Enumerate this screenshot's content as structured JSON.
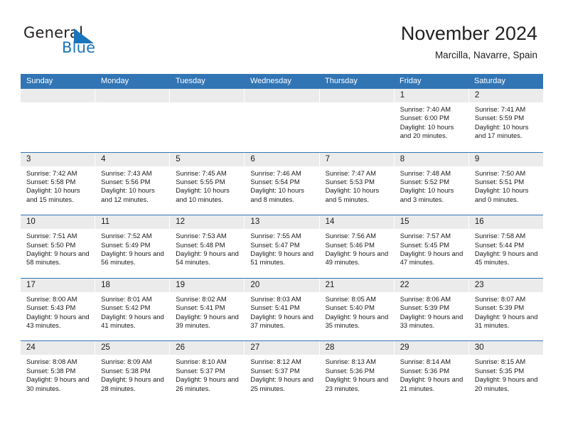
{
  "brand": {
    "name_top": "General",
    "name_bottom": "Blue",
    "top_color": "#231f20",
    "bottom_color": "#1b75bb",
    "triangle_color": "#1b75bb"
  },
  "header": {
    "title": "November 2024",
    "subtitle": "Marcilla, Navarre, Spain"
  },
  "theme": {
    "header_blue": "#3275b5",
    "daynum_band": "#ebebeb",
    "text": "#1a1a1a"
  },
  "calendar": {
    "weekday_headers": [
      "Sunday",
      "Monday",
      "Tuesday",
      "Wednesday",
      "Thursday",
      "Friday",
      "Saturday"
    ],
    "labels": {
      "sunrise": "Sunrise:",
      "sunset": "Sunset:",
      "daylight": "Daylight:"
    },
    "weeks": [
      [
        {
          "day": "",
          "empty": true
        },
        {
          "day": "",
          "empty": true
        },
        {
          "day": "",
          "empty": true
        },
        {
          "day": "",
          "empty": true
        },
        {
          "day": "",
          "empty": true
        },
        {
          "day": "1",
          "sunrise": "Sunrise: 7:40 AM",
          "sunset": "Sunset: 6:00 PM",
          "daylight": "Daylight: 10 hours and 20 minutes."
        },
        {
          "day": "2",
          "sunrise": "Sunrise: 7:41 AM",
          "sunset": "Sunset: 5:59 PM",
          "daylight": "Daylight: 10 hours and 17 minutes."
        }
      ],
      [
        {
          "day": "3",
          "sunrise": "Sunrise: 7:42 AM",
          "sunset": "Sunset: 5:58 PM",
          "daylight": "Daylight: 10 hours and 15 minutes."
        },
        {
          "day": "4",
          "sunrise": "Sunrise: 7:43 AM",
          "sunset": "Sunset: 5:56 PM",
          "daylight": "Daylight: 10 hours and 12 minutes."
        },
        {
          "day": "5",
          "sunrise": "Sunrise: 7:45 AM",
          "sunset": "Sunset: 5:55 PM",
          "daylight": "Daylight: 10 hours and 10 minutes."
        },
        {
          "day": "6",
          "sunrise": "Sunrise: 7:46 AM",
          "sunset": "Sunset: 5:54 PM",
          "daylight": "Daylight: 10 hours and 8 minutes."
        },
        {
          "day": "7",
          "sunrise": "Sunrise: 7:47 AM",
          "sunset": "Sunset: 5:53 PM",
          "daylight": "Daylight: 10 hours and 5 minutes."
        },
        {
          "day": "8",
          "sunrise": "Sunrise: 7:48 AM",
          "sunset": "Sunset: 5:52 PM",
          "daylight": "Daylight: 10 hours and 3 minutes."
        },
        {
          "day": "9",
          "sunrise": "Sunrise: 7:50 AM",
          "sunset": "Sunset: 5:51 PM",
          "daylight": "Daylight: 10 hours and 0 minutes."
        }
      ],
      [
        {
          "day": "10",
          "sunrise": "Sunrise: 7:51 AM",
          "sunset": "Sunset: 5:50 PM",
          "daylight": "Daylight: 9 hours and 58 minutes."
        },
        {
          "day": "11",
          "sunrise": "Sunrise: 7:52 AM",
          "sunset": "Sunset: 5:49 PM",
          "daylight": "Daylight: 9 hours and 56 minutes."
        },
        {
          "day": "12",
          "sunrise": "Sunrise: 7:53 AM",
          "sunset": "Sunset: 5:48 PM",
          "daylight": "Daylight: 9 hours and 54 minutes."
        },
        {
          "day": "13",
          "sunrise": "Sunrise: 7:55 AM",
          "sunset": "Sunset: 5:47 PM",
          "daylight": "Daylight: 9 hours and 51 minutes."
        },
        {
          "day": "14",
          "sunrise": "Sunrise: 7:56 AM",
          "sunset": "Sunset: 5:46 PM",
          "daylight": "Daylight: 9 hours and 49 minutes."
        },
        {
          "day": "15",
          "sunrise": "Sunrise: 7:57 AM",
          "sunset": "Sunset: 5:45 PM",
          "daylight": "Daylight: 9 hours and 47 minutes."
        },
        {
          "day": "16",
          "sunrise": "Sunrise: 7:58 AM",
          "sunset": "Sunset: 5:44 PM",
          "daylight": "Daylight: 9 hours and 45 minutes."
        }
      ],
      [
        {
          "day": "17",
          "sunrise": "Sunrise: 8:00 AM",
          "sunset": "Sunset: 5:43 PM",
          "daylight": "Daylight: 9 hours and 43 minutes."
        },
        {
          "day": "18",
          "sunrise": "Sunrise: 8:01 AM",
          "sunset": "Sunset: 5:42 PM",
          "daylight": "Daylight: 9 hours and 41 minutes."
        },
        {
          "day": "19",
          "sunrise": "Sunrise: 8:02 AM",
          "sunset": "Sunset: 5:41 PM",
          "daylight": "Daylight: 9 hours and 39 minutes."
        },
        {
          "day": "20",
          "sunrise": "Sunrise: 8:03 AM",
          "sunset": "Sunset: 5:41 PM",
          "daylight": "Daylight: 9 hours and 37 minutes."
        },
        {
          "day": "21",
          "sunrise": "Sunrise: 8:05 AM",
          "sunset": "Sunset: 5:40 PM",
          "daylight": "Daylight: 9 hours and 35 minutes."
        },
        {
          "day": "22",
          "sunrise": "Sunrise: 8:06 AM",
          "sunset": "Sunset: 5:39 PM",
          "daylight": "Daylight: 9 hours and 33 minutes."
        },
        {
          "day": "23",
          "sunrise": "Sunrise: 8:07 AM",
          "sunset": "Sunset: 5:39 PM",
          "daylight": "Daylight: 9 hours and 31 minutes."
        }
      ],
      [
        {
          "day": "24",
          "sunrise": "Sunrise: 8:08 AM",
          "sunset": "Sunset: 5:38 PM",
          "daylight": "Daylight: 9 hours and 30 minutes."
        },
        {
          "day": "25",
          "sunrise": "Sunrise: 8:09 AM",
          "sunset": "Sunset: 5:38 PM",
          "daylight": "Daylight: 9 hours and 28 minutes."
        },
        {
          "day": "26",
          "sunrise": "Sunrise: 8:10 AM",
          "sunset": "Sunset: 5:37 PM",
          "daylight": "Daylight: 9 hours and 26 minutes."
        },
        {
          "day": "27",
          "sunrise": "Sunrise: 8:12 AM",
          "sunset": "Sunset: 5:37 PM",
          "daylight": "Daylight: 9 hours and 25 minutes."
        },
        {
          "day": "28",
          "sunrise": "Sunrise: 8:13 AM",
          "sunset": "Sunset: 5:36 PM",
          "daylight": "Daylight: 9 hours and 23 minutes."
        },
        {
          "day": "29",
          "sunrise": "Sunrise: 8:14 AM",
          "sunset": "Sunset: 5:36 PM",
          "daylight": "Daylight: 9 hours and 21 minutes."
        },
        {
          "day": "30",
          "sunrise": "Sunrise: 8:15 AM",
          "sunset": "Sunset: 5:35 PM",
          "daylight": "Daylight: 9 hours and 20 minutes."
        }
      ]
    ]
  }
}
